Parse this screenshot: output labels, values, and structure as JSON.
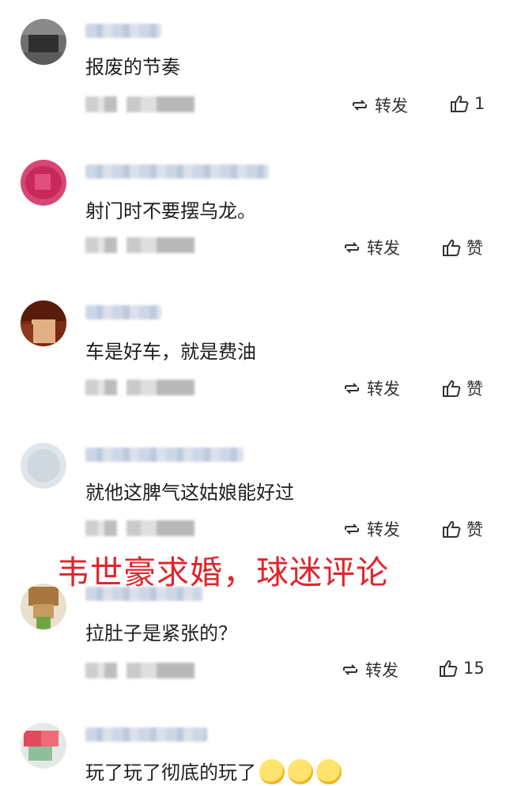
{
  "comments": [
    {
      "text": "报废的节奏",
      "repost_label": "转发",
      "like_label": "1"
    },
    {
      "text": "射门时不要摆乌龙。",
      "repost_label": "转发",
      "like_label": "赞"
    },
    {
      "text": "车是好车，就是费油",
      "repost_label": "转发",
      "like_label": "赞"
    },
    {
      "text": "就他这脾气这姑娘能好过",
      "repost_label": "转发",
      "like_label": "赞"
    },
    {
      "text": "拉肚子是紧张的？",
      "repost_label": "转发",
      "like_label": "15"
    },
    {
      "text": "玩了玩了彻底的玩了",
      "repost_label": "",
      "like_label": ""
    }
  ],
  "overlay_title": "韦世豪求婚，球迷评论",
  "icons": {
    "repost": "repost-icon",
    "like": "thumbs-up-icon",
    "emoji": "laughing-crying-emoji-icon"
  },
  "colors": {
    "overlay_title": "#e0252b",
    "text": "#1e1e1e",
    "muted": "#333333"
  }
}
